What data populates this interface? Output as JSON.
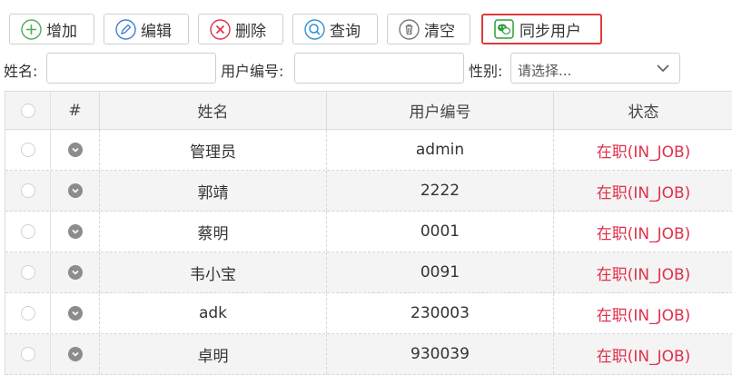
{
  "toolbar": {
    "add": "增加",
    "edit": "编辑",
    "delete": "删除",
    "query": "查询",
    "clear": "清空",
    "sync": "同步用户"
  },
  "filters": {
    "name_label": "姓名:",
    "name_value": "",
    "code_label": "用户编号:",
    "code_value": "",
    "gender_label": "性别:",
    "gender_selected": "请选择..."
  },
  "grid": {
    "headers": [
      "#",
      "姓名",
      "用户编号",
      "状态"
    ],
    "rows": [
      {
        "name": "管理员",
        "code": "admin",
        "status": "在职(IN_JOB)"
      },
      {
        "name": "郭靖",
        "code": "2222",
        "status": "在职(IN_JOB)"
      },
      {
        "name": "蔡明",
        "code": "0001",
        "status": "在职(IN_JOB)"
      },
      {
        "name": "韦小宝",
        "code": "0091",
        "status": "在职(IN_JOB)"
      },
      {
        "name": "adk",
        "code": "230003",
        "status": "在职(IN_JOB)"
      },
      {
        "name": "卓明",
        "code": "930039",
        "status": "在职(IN_JOB)"
      }
    ]
  },
  "colors": {
    "status_text": "#e0304a",
    "highlight_border": "#e03a3a",
    "add_icon": "#4caf50",
    "edit_icon": "#3d7fd6",
    "delete_icon": "#e0304a",
    "query_icon": "#2e8fd6",
    "sync_icon": "#2e9e3a"
  },
  "icons": {
    "add": "plus-circle-icon",
    "edit": "pencil-circle-icon",
    "delete": "x-circle-icon",
    "query": "magnifier-circle-icon",
    "clear": "trash-circle-icon",
    "sync": "wechat-icon"
  }
}
